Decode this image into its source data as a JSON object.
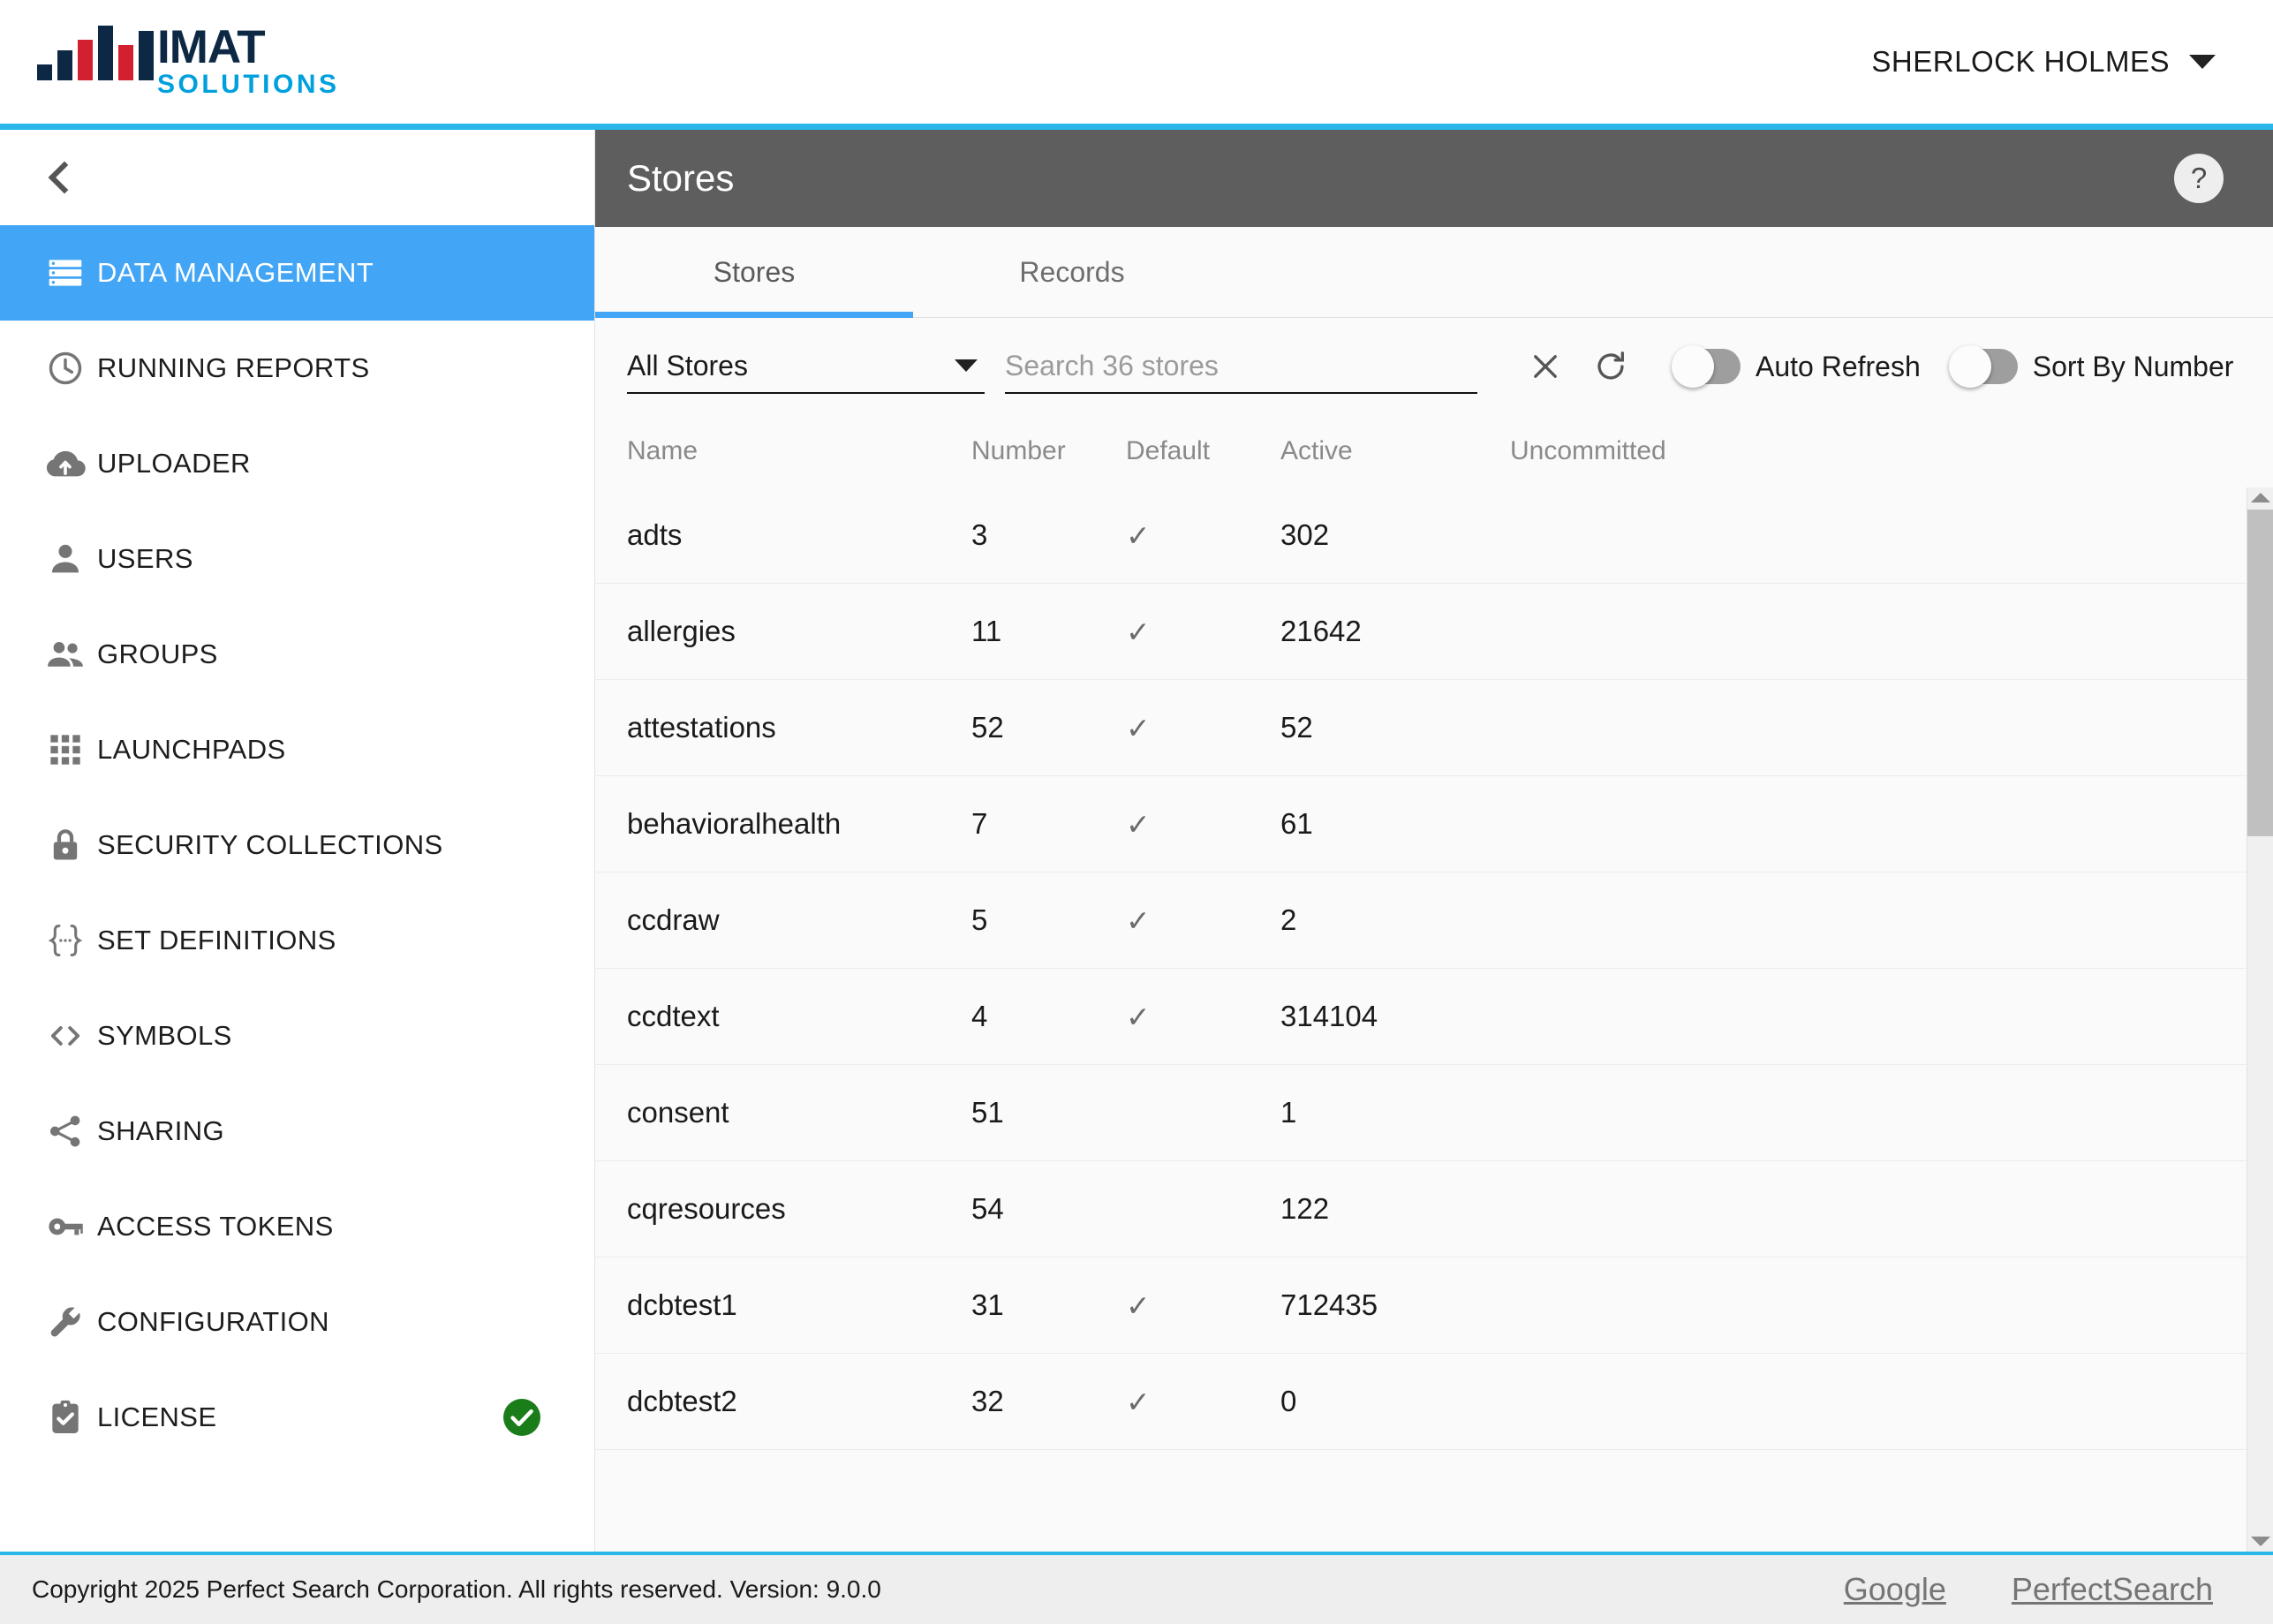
{
  "brand": {
    "name_primary": "IMAT",
    "name_secondary": "SOLUTIONS",
    "logo_icon": "bar-chart-logo-icon",
    "bar_colors": [
      "#0d2844",
      "#0d2844",
      "#d32030",
      "#0d2844",
      "#d32030",
      "#0d2844"
    ]
  },
  "topbar": {
    "user_name": "SHERLOCK HOLMES",
    "user_caret_icon": "caret-down-icon",
    "accent_color": "#29b6e8"
  },
  "sidebar": {
    "collapse_icon": "chevron-left-icon",
    "active_color": "#42a5f5",
    "items": [
      {
        "label": "DATA MANAGEMENT",
        "icon": "storage-icon",
        "active": true
      },
      {
        "label": "RUNNING REPORTS",
        "icon": "clock-icon",
        "active": false
      },
      {
        "label": "UPLOADER",
        "icon": "cloud-upload-icon",
        "active": false
      },
      {
        "label": "USERS",
        "icon": "person-icon",
        "active": false
      },
      {
        "label": "GROUPS",
        "icon": "people-icon",
        "active": false
      },
      {
        "label": "LAUNCHPADS",
        "icon": "grid-apps-icon",
        "active": false
      },
      {
        "label": "SECURITY COLLECTIONS",
        "icon": "lock-icon",
        "active": false
      },
      {
        "label": "SET DEFINITIONS",
        "icon": "braces-icon",
        "active": false
      },
      {
        "label": "SYMBOLS",
        "icon": "code-brackets-icon",
        "active": false
      },
      {
        "label": "SHARING",
        "icon": "share-icon",
        "active": false
      },
      {
        "label": "ACCESS TOKENS",
        "icon": "key-icon",
        "active": false
      },
      {
        "label": "CONFIGURATION",
        "icon": "wrench-icon",
        "active": false
      },
      {
        "label": "LICENSE",
        "icon": "clipboard-check-icon",
        "active": false,
        "badge_icon": "green-check-badge-icon",
        "badge_color": "#1a7d1a"
      }
    ]
  },
  "page": {
    "title": "Stores",
    "help_icon": "help-question-icon",
    "header_color": "#5e5e5e"
  },
  "tabs": [
    {
      "label": "Stores",
      "active": true
    },
    {
      "label": "Records",
      "active": false
    }
  ],
  "toolbar": {
    "filter_value": "All Stores",
    "filter_caret_icon": "caret-down-icon",
    "search_value": "",
    "search_placeholder": "Search 36 stores",
    "clear_icon": "close-x-icon",
    "refresh_icon": "refresh-icon",
    "toggles": [
      {
        "label": "Auto Refresh",
        "on": false
      },
      {
        "label": "Sort By Number",
        "on": false
      }
    ]
  },
  "table": {
    "columns": [
      "Name",
      "Number",
      "Default",
      "Active",
      "Uncommitted"
    ],
    "check_glyph": "✓",
    "rows": [
      {
        "name": "adts",
        "number": "3",
        "default": true,
        "active": "302",
        "uncommitted": ""
      },
      {
        "name": "allergies",
        "number": "11",
        "default": true,
        "active": "21642",
        "uncommitted": ""
      },
      {
        "name": "attestations",
        "number": "52",
        "default": true,
        "active": "52",
        "uncommitted": ""
      },
      {
        "name": "behavioralhealth",
        "number": "7",
        "default": true,
        "active": "61",
        "uncommitted": ""
      },
      {
        "name": "ccdraw",
        "number": "5",
        "default": true,
        "active": "2",
        "uncommitted": ""
      },
      {
        "name": "ccdtext",
        "number": "4",
        "default": true,
        "active": "314104",
        "uncommitted": ""
      },
      {
        "name": "consent",
        "number": "51",
        "default": false,
        "active": "1",
        "uncommitted": ""
      },
      {
        "name": "cqresources",
        "number": "54",
        "default": false,
        "active": "122",
        "uncommitted": ""
      },
      {
        "name": "dcbtest1",
        "number": "31",
        "default": true,
        "active": "712435",
        "uncommitted": ""
      },
      {
        "name": "dcbtest2",
        "number": "32",
        "default": true,
        "active": "0",
        "uncommitted": ""
      }
    ]
  },
  "scrollbar": {
    "up_icon": "scroll-up-arrow-icon",
    "down_icon": "scroll-down-arrow-icon"
  },
  "footer": {
    "copyright": "Copyright 2025 Perfect Search Corporation. All rights reserved. Version: 9.0.0",
    "links": [
      {
        "label": "Google"
      },
      {
        "label": "PerfectSearch"
      }
    ]
  }
}
